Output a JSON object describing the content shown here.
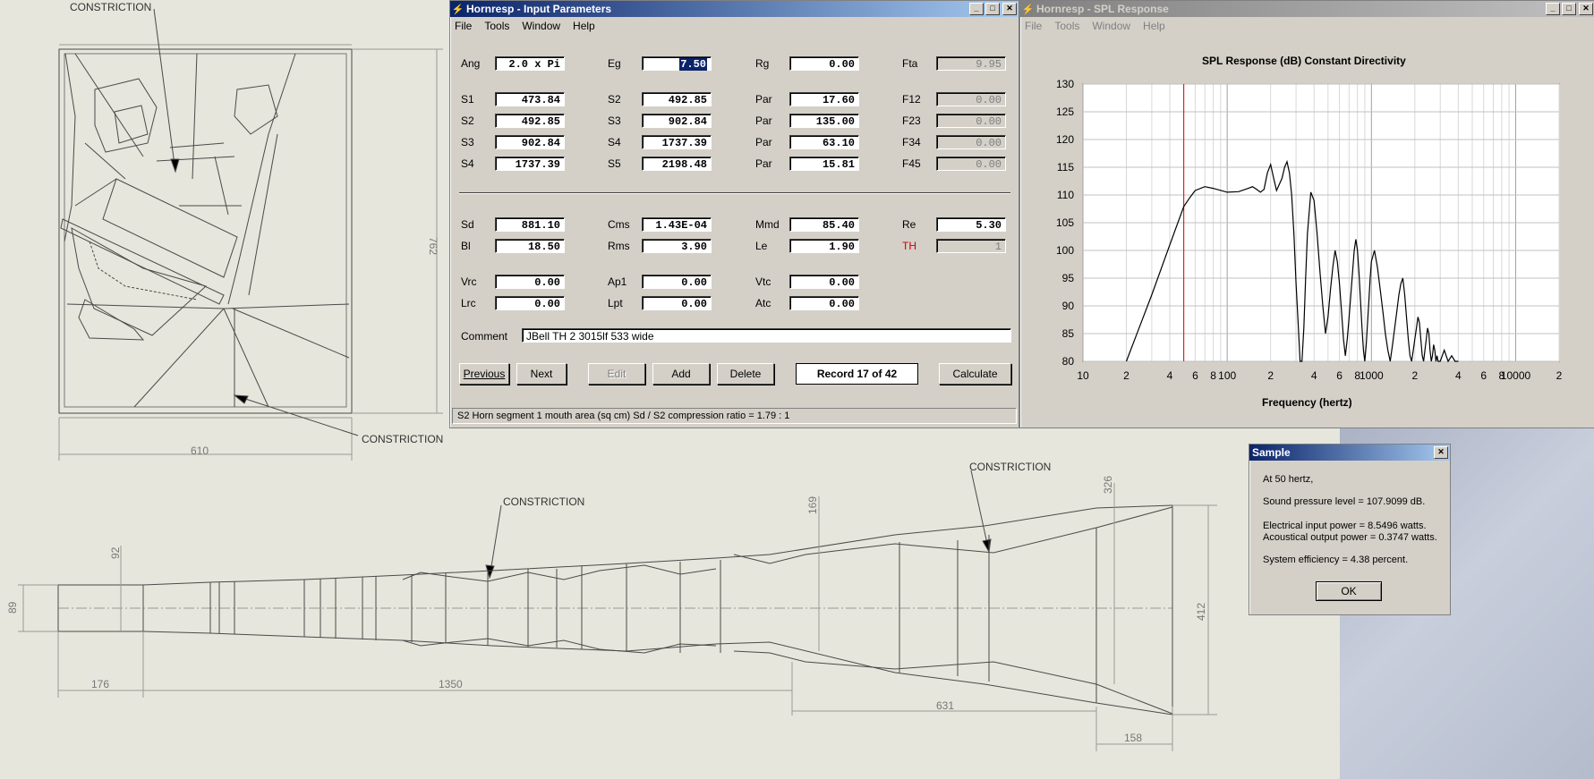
{
  "drawing": {
    "constriction_label": "CONSTRICTION",
    "dims": {
      "d762": "762",
      "d610": "610",
      "d92": "92",
      "d89": "89",
      "d176": "176",
      "d1350": "1350",
      "d169": "169",
      "d326": "326",
      "d412": "412",
      "d631": "631",
      "d158": "158"
    }
  },
  "input_window": {
    "title": "Hornresp - Input Parameters",
    "menu": [
      "File",
      "Tools",
      "Window",
      "Help"
    ],
    "rows": [
      [
        {
          "label": "Ang",
          "value": "2.0 x Pi"
        },
        {
          "label": "Eg",
          "value": "7.50",
          "selected": true
        },
        {
          "label": "Rg",
          "value": "0.00"
        },
        {
          "label": "Fta",
          "value": "9.95",
          "gray": true
        }
      ],
      [
        {
          "label": "S1",
          "value": "473.84"
        },
        {
          "label": "S2",
          "value": "492.85"
        },
        {
          "label": "Par",
          "value": "17.60"
        },
        {
          "label": "F12",
          "value": "0.00",
          "gray": true
        }
      ],
      [
        {
          "label": "S2",
          "value": "492.85"
        },
        {
          "label": "S3",
          "value": "902.84"
        },
        {
          "label": "Par",
          "value": "135.00"
        },
        {
          "label": "F23",
          "value": "0.00",
          "gray": true
        }
      ],
      [
        {
          "label": "S3",
          "value": "902.84"
        },
        {
          "label": "S4",
          "value": "1737.39"
        },
        {
          "label": "Par",
          "value": "63.10"
        },
        {
          "label": "F34",
          "value": "0.00",
          "gray": true
        }
      ],
      [
        {
          "label": "S4",
          "value": "1737.39"
        },
        {
          "label": "S5",
          "value": "2198.48"
        },
        {
          "label": "Par",
          "value": "15.81"
        },
        {
          "label": "F45",
          "value": "0.00",
          "gray": true
        }
      ],
      [
        {
          "label": "Sd",
          "value": "881.10"
        },
        {
          "label": "Cms",
          "value": "1.43E-04"
        },
        {
          "label": "Mmd",
          "value": "85.40"
        },
        {
          "label": "Re",
          "value": "5.30"
        }
      ],
      [
        {
          "label": "Bl",
          "value": "18.50"
        },
        {
          "label": "Rms",
          "value": "3.90"
        },
        {
          "label": "Le",
          "value": "1.90"
        },
        {
          "label": "TH",
          "value": "1",
          "gray": true,
          "red": true
        }
      ],
      [
        {
          "label": "Vrc",
          "value": "0.00"
        },
        {
          "label": "Ap1",
          "value": "0.00"
        },
        {
          "label": "Vtc",
          "value": "0.00"
        }
      ],
      [
        {
          "label": "Lrc",
          "value": "0.00"
        },
        {
          "label": "Lpt",
          "value": "0.00"
        },
        {
          "label": "Atc",
          "value": "0.00"
        }
      ]
    ],
    "comment_label": "Comment",
    "comment_value": "JBell TH 2 3015lf 533 wide",
    "buttons": {
      "previous": "Previous",
      "next": "Next",
      "edit": "Edit",
      "add": "Add",
      "delete": "Delete",
      "calculate": "Calculate"
    },
    "record": "Record 17 of 42",
    "status": "S2   Horn segment 1 mouth area  (sq cm)   Sd / S2 compression ratio = 1.79 : 1"
  },
  "spl_window": {
    "title": "Hornresp - SPL Response",
    "menu": [
      "File",
      "Tools",
      "Window",
      "Help"
    ]
  },
  "chart_data": {
    "type": "line",
    "title": "SPL Response (dB)   Constant Directivity",
    "xlabel": "Frequency (hertz)",
    "ylabel": "",
    "x_scale": "log",
    "xlim": [
      10,
      20000
    ],
    "ylim": [
      80,
      130
    ],
    "yticks": [
      80,
      85,
      90,
      95,
      100,
      105,
      110,
      115,
      120,
      125,
      130
    ],
    "xtick_labels": [
      "10",
      "2",
      "4",
      "6",
      "8",
      "100",
      "2",
      "4",
      "6",
      "8",
      "1000",
      "2",
      "4",
      "6",
      "8",
      "10000",
      "2"
    ],
    "marker_frequency": 50,
    "series": [
      {
        "x": [
          20,
          30,
          40,
          50,
          55,
          60,
          70,
          80,
          100,
          120,
          140,
          150,
          160,
          170,
          180,
          190,
          200,
          210,
          220,
          240,
          250,
          260,
          270,
          280,
          290,
          300,
          310,
          320,
          330,
          340,
          350,
          360,
          380,
          400,
          420,
          440,
          460,
          480,
          500,
          520,
          540,
          560,
          580,
          600,
          620,
          640,
          660,
          680,
          700,
          720,
          740,
          760,
          780,
          800,
          820,
          840,
          860,
          880,
          900,
          920,
          940,
          960,
          980,
          1000,
          1050,
          1100,
          1150,
          1200,
          1250,
          1300,
          1350,
          1400,
          1450,
          1500,
          1550,
          1600,
          1650,
          1700,
          1750,
          1800,
          1850,
          1900,
          1950,
          2000,
          2050,
          2100,
          2150,
          2200,
          2250,
          2300,
          2350,
          2400,
          2450,
          2500,
          2550,
          2600,
          2650,
          2700,
          2750,
          2800,
          2850,
          2900,
          3000,
          3200,
          3400,
          3600,
          3800,
          4000
        ],
        "values": [
          80,
          92,
          101,
          107.9,
          109.5,
          110.8,
          111.5,
          111.2,
          110.5,
          110.6,
          111.2,
          111.5,
          111,
          110.5,
          111,
          114,
          115.5,
          113,
          110.8,
          113,
          115,
          116,
          114,
          110,
          103,
          94,
          87,
          80,
          80,
          86,
          95,
          103,
          110.5,
          109,
          103,
          96,
          90,
          85,
          88,
          93,
          97,
          100,
          98,
          94,
          89,
          84,
          81,
          84,
          88,
          92,
          96,
          100,
          102,
          100,
          96,
          91,
          86,
          82,
          80,
          83,
          87,
          91,
          95,
          98,
          100,
          97,
          93,
          89,
          85,
          82,
          80,
          83,
          86,
          89,
          92,
          94,
          95,
          92,
          88,
          84,
          81,
          80,
          82,
          84,
          86,
          88,
          87,
          84,
          81,
          80,
          82,
          84,
          86,
          85,
          82,
          80,
          81,
          83,
          82,
          80,
          81,
          80,
          80,
          82,
          80,
          81,
          80,
          80
        ]
      }
    ]
  },
  "dialog": {
    "title": "Sample",
    "line1": "At 50 hertz,",
    "line2": "Sound pressure level = 107.9099 dB.",
    "line3": "Electrical input power = 8.5496 watts.",
    "line4": "Acoustical output power = 0.3747 watts.",
    "line5": "System efficiency = 4.38 percent.",
    "ok": "OK"
  }
}
